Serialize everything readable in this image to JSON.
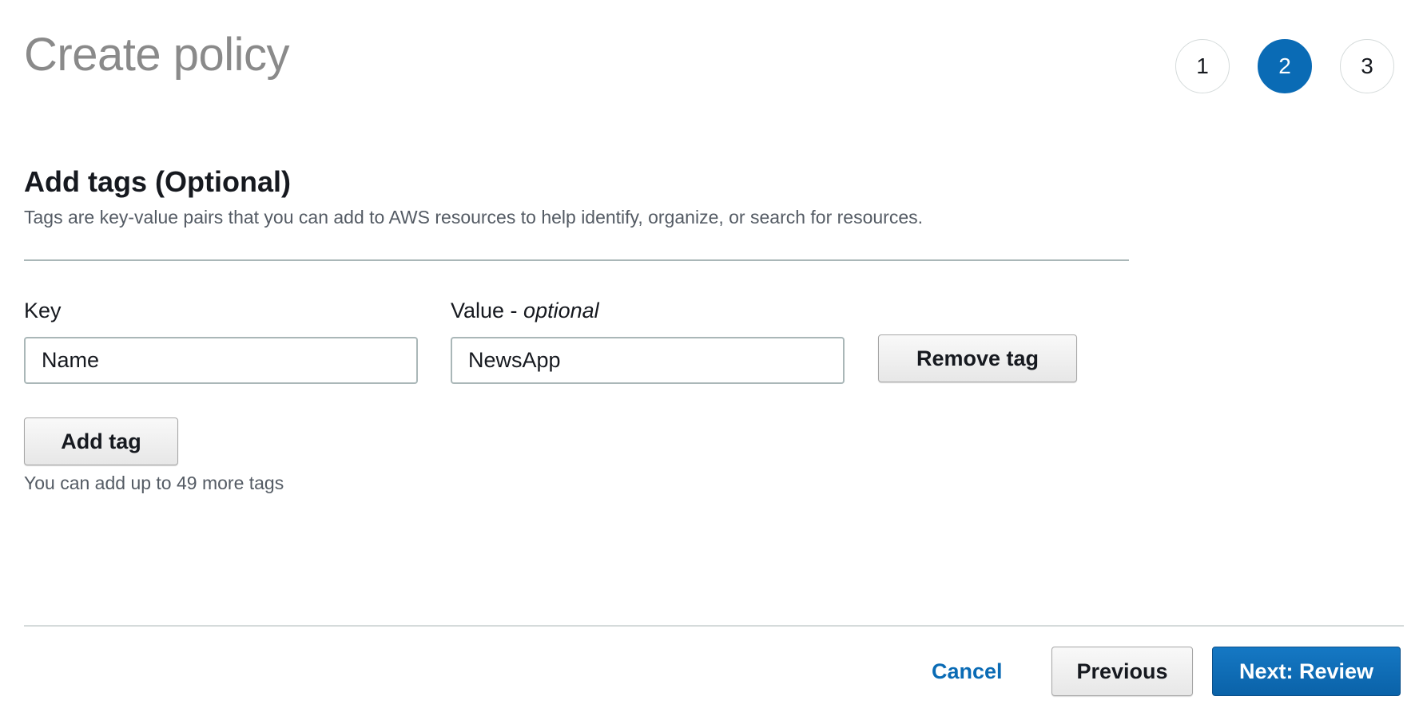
{
  "header": {
    "title": "Create policy",
    "steps": [
      {
        "label": "1",
        "active": false
      },
      {
        "label": "2",
        "active": true
      },
      {
        "label": "3",
        "active": false
      }
    ]
  },
  "tags_section": {
    "heading": "Add tags (Optional)",
    "description": "Tags are key-value pairs that you can add to AWS resources to help identify, organize, or search for resources.",
    "key_label": "Key",
    "value_label_main": "Value - ",
    "value_label_optional": "optional",
    "tag_rows": [
      {
        "key": "Name",
        "value": "NewsApp"
      }
    ],
    "remove_tag_label": "Remove tag",
    "add_tag_label": "Add tag",
    "helper_text": "You can add up to 49 more tags"
  },
  "footer": {
    "cancel_label": "Cancel",
    "previous_label": "Previous",
    "next_label": "Next: Review"
  },
  "colors": {
    "primary": "#0a6bb5",
    "title_gray": "#8a8a8a",
    "divider": "#aab7b8"
  }
}
